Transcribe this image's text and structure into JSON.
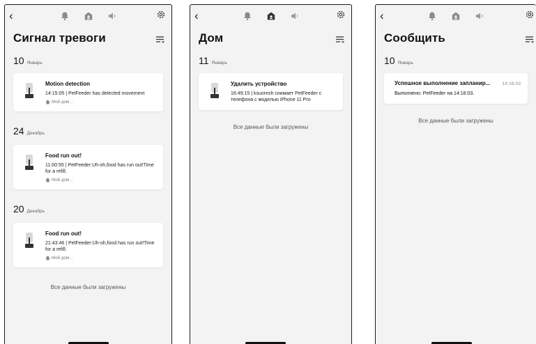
{
  "screens": [
    {
      "title": "Сигнал тревоги",
      "groups": [
        {
          "day": "10",
          "month": "Январь",
          "card": {
            "title": "Motion detection",
            "body": "14:15:05 | PetFeeder has detected movement",
            "location": "Мой дом .."
          }
        },
        {
          "day": "24",
          "month": "Декабрь",
          "card": {
            "title": "Food run out!",
            "body": "11:00:55 | PetFeeder:Uh-oh,food has run out!Time for a refill.",
            "location": "Мой дом .."
          }
        },
        {
          "day": "20",
          "month": "Декабрь",
          "card": {
            "title": "Food run out!",
            "body": "21:43:46 | PetFeeder:Uh-oh,food has run out!Time for a refill.",
            "location": "Мой дом .."
          }
        }
      ],
      "footer": "Все данные были загружены"
    },
    {
      "title": "Дом",
      "groups": [
        {
          "day": "11",
          "month": "Январь",
          "card": {
            "title": "Удалить устройство",
            "body": "16:49:15 | ksuoresh снимает PetFeeder с телефона с моделью iPhone 11 Pro"
          }
        }
      ],
      "footer": "Все данные были загружены"
    },
    {
      "title": "Сообщить",
      "groups": [
        {
          "day": "10",
          "month": "Январь",
          "card": {
            "title": "Успешное выполнение запланир...",
            "time": "14:16:03",
            "body": "Выполнено: PetFeeder на 14:16:03."
          }
        }
      ],
      "footer": "Все данные были загружены"
    }
  ],
  "icons": {
    "back": "back-chevron-icon",
    "tabs": [
      "bell-icon",
      "home-icon",
      "speaker-icon"
    ],
    "settings": "gear-icon",
    "filter": "filter-list-icon",
    "device": "pet-feeder-icon",
    "location": "home-small-icon"
  }
}
